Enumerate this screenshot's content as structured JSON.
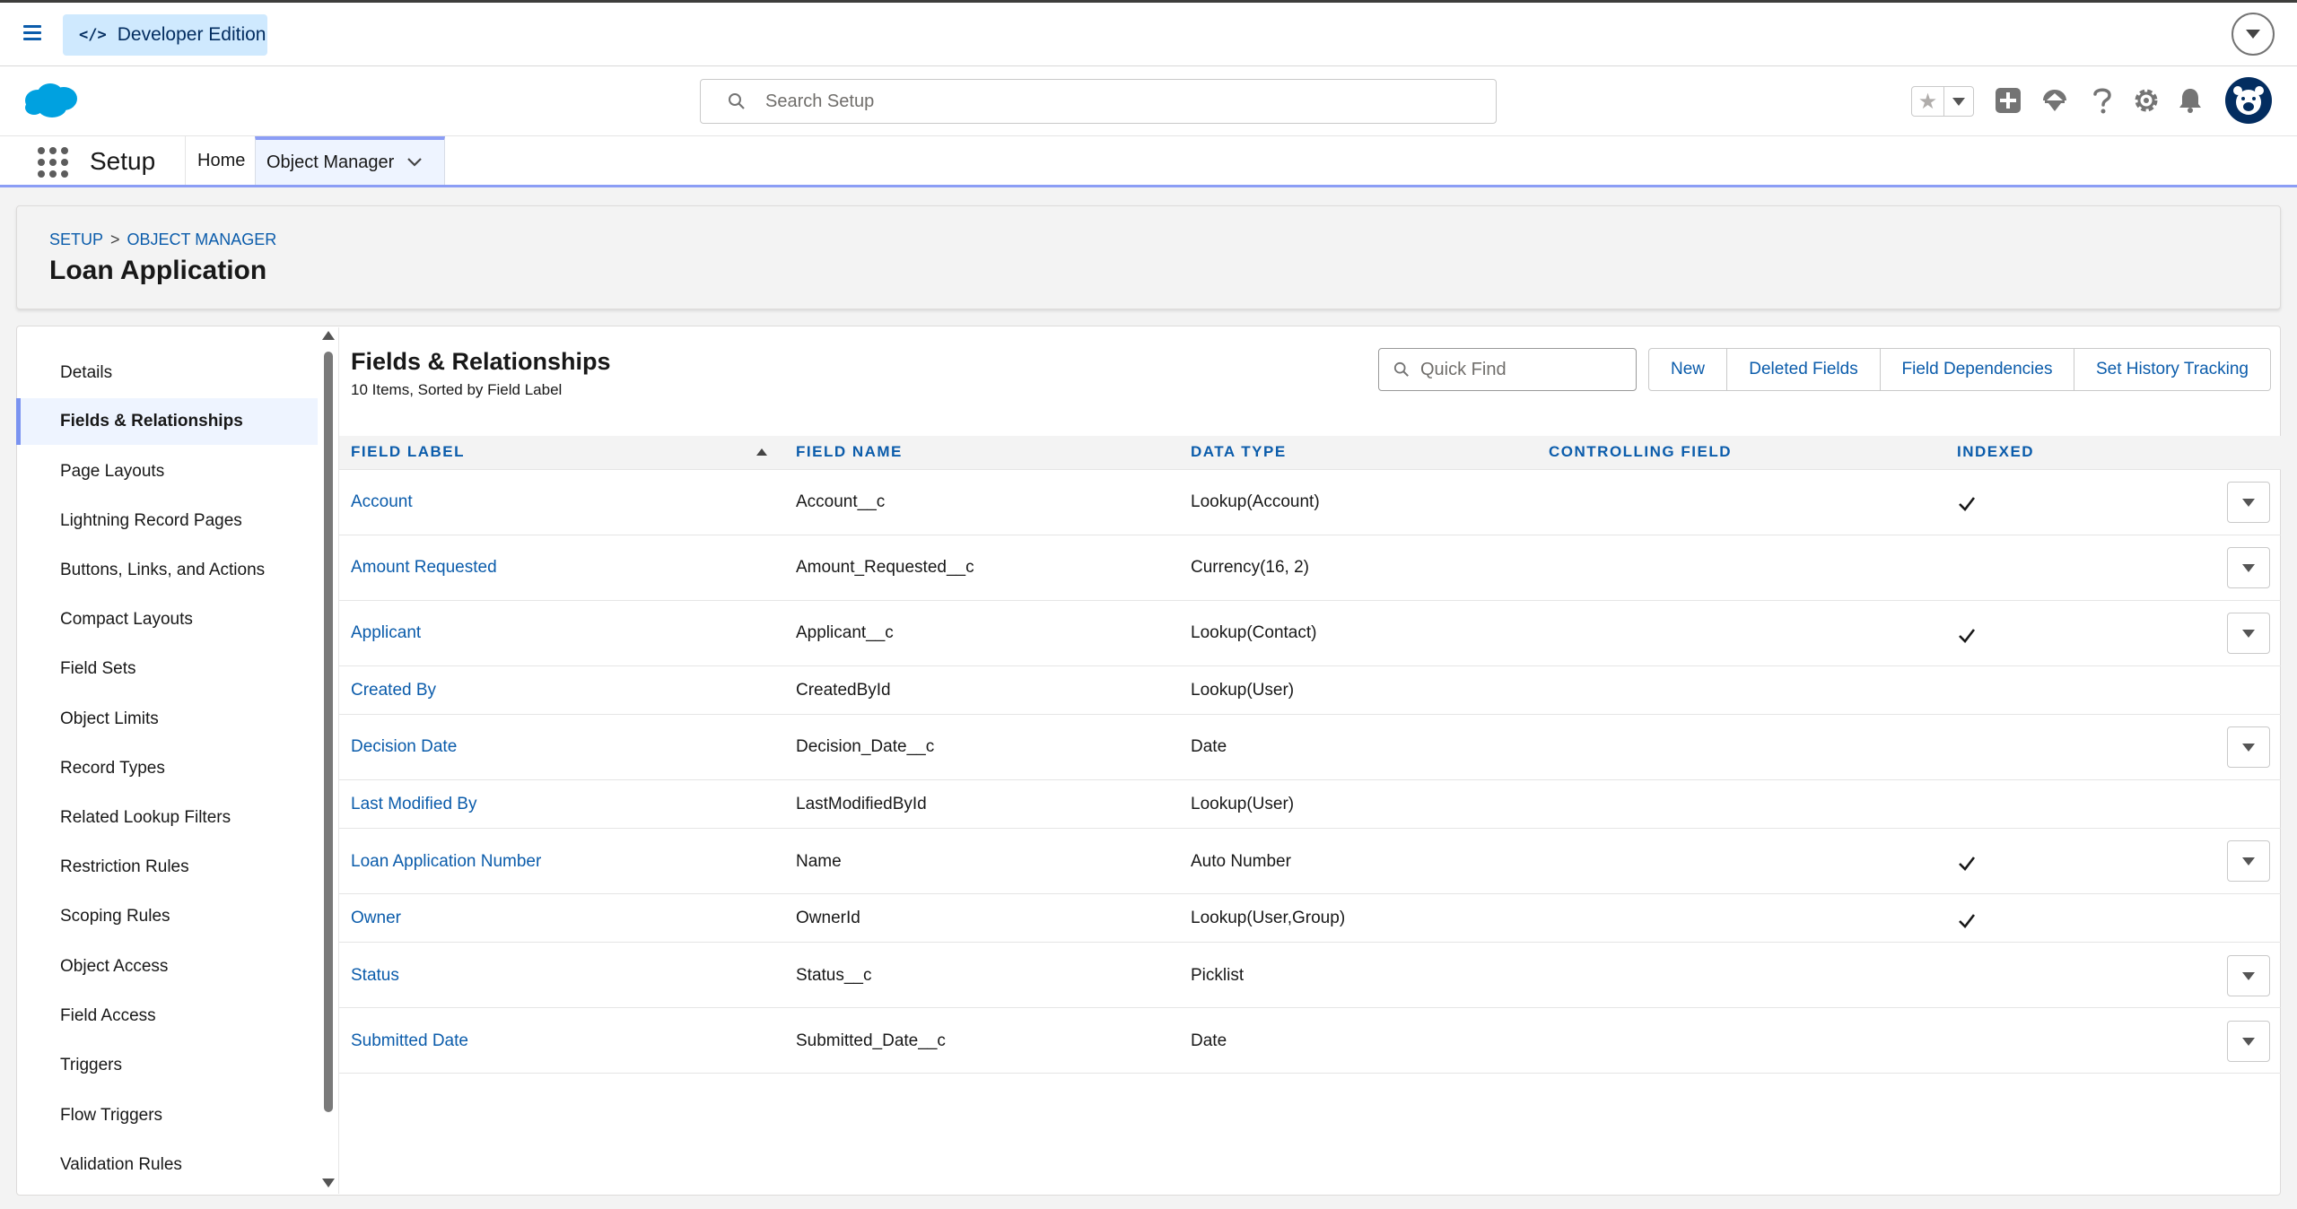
{
  "devbar": {
    "code_glyph": "</>",
    "edition_label": "Developer Edition"
  },
  "header": {
    "search_placeholder": "Search Setup"
  },
  "appnav": {
    "app_name": "Setup",
    "home_label": "Home",
    "object_manager_label": "Object Manager"
  },
  "page": {
    "breadcrumb": [
      "SETUP",
      ">",
      "OBJECT MANAGER"
    ],
    "title": "Loan Application"
  },
  "sidebar": {
    "items": [
      {
        "label": "Details",
        "active": false
      },
      {
        "label": "Fields & Relationships",
        "active": true
      },
      {
        "label": "Page Layouts",
        "active": false
      },
      {
        "label": "Lightning Record Pages",
        "active": false
      },
      {
        "label": "Buttons, Links, and Actions",
        "active": false
      },
      {
        "label": "Compact Layouts",
        "active": false
      },
      {
        "label": "Field Sets",
        "active": false
      },
      {
        "label": "Object Limits",
        "active": false
      },
      {
        "label": "Record Types",
        "active": false
      },
      {
        "label": "Related Lookup Filters",
        "active": false
      },
      {
        "label": "Restriction Rules",
        "active": false
      },
      {
        "label": "Scoping Rules",
        "active": false
      },
      {
        "label": "Object Access",
        "active": false
      },
      {
        "label": "Field Access",
        "active": false
      },
      {
        "label": "Triggers",
        "active": false
      },
      {
        "label": "Flow Triggers",
        "active": false
      },
      {
        "label": "Validation Rules",
        "active": false
      }
    ]
  },
  "section": {
    "title": "Fields & Relationships",
    "subtitle": "10 Items, Sorted by Field Label",
    "quickfind_placeholder": "Quick Find",
    "buttons": [
      "New",
      "Deleted Fields",
      "Field Dependencies",
      "Set History Tracking"
    ]
  },
  "table": {
    "columns": [
      "FIELD LABEL",
      "FIELD NAME",
      "DATA TYPE",
      "CONTROLLING FIELD",
      "INDEXED"
    ],
    "rows": [
      {
        "label": "Account",
        "name": "Account__c",
        "type": "Lookup(Account)",
        "controlling": "",
        "indexed": true,
        "menu": true
      },
      {
        "label": "Amount Requested",
        "name": "Amount_Requested__c",
        "type": "Currency(16, 2)",
        "controlling": "",
        "indexed": false,
        "menu": true
      },
      {
        "label": "Applicant",
        "name": "Applicant__c",
        "type": "Lookup(Contact)",
        "controlling": "",
        "indexed": true,
        "menu": true
      },
      {
        "label": "Created By",
        "name": "CreatedById",
        "type": "Lookup(User)",
        "controlling": "",
        "indexed": false,
        "menu": false
      },
      {
        "label": "Decision Date",
        "name": "Decision_Date__c",
        "type": "Date",
        "controlling": "",
        "indexed": false,
        "menu": true
      },
      {
        "label": "Last Modified By",
        "name": "LastModifiedById",
        "type": "Lookup(User)",
        "controlling": "",
        "indexed": false,
        "menu": false
      },
      {
        "label": "Loan Application Number",
        "name": "Name",
        "type": "Auto Number",
        "controlling": "",
        "indexed": true,
        "menu": true
      },
      {
        "label": "Owner",
        "name": "OwnerId",
        "type": "Lookup(User,Group)",
        "controlling": "",
        "indexed": true,
        "menu": false
      },
      {
        "label": "Status",
        "name": "Status__c",
        "type": "Picklist",
        "controlling": "",
        "indexed": false,
        "menu": true
      },
      {
        "label": "Submitted Date",
        "name": "Submitted_Date__c",
        "type": "Date",
        "controlling": "",
        "indexed": false,
        "menu": true
      }
    ]
  },
  "colors": {
    "brand_blue": "#0b5cab",
    "nav_accent": "#8b9df5",
    "salesforce_cloud": "#00a1e0"
  }
}
